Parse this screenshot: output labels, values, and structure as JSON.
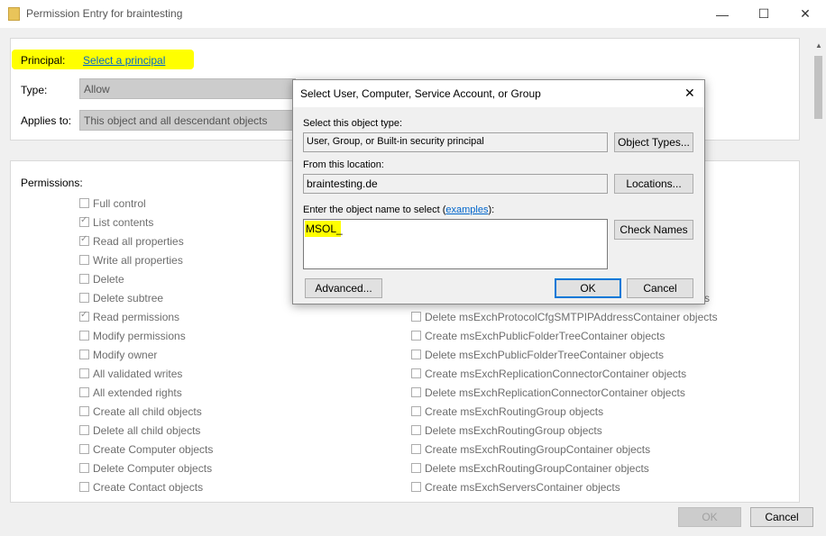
{
  "window": {
    "title": "Permission Entry for braintesting",
    "minimize": "—",
    "maximize": "☐",
    "close": "✕"
  },
  "principal": {
    "label": "Principal:",
    "link": "Select a principal",
    "highlight_color": "#ffff00"
  },
  "type": {
    "label": "Type:",
    "value": "Allow"
  },
  "applies": {
    "label": "Applies to:",
    "value": "This object and all descendant objects"
  },
  "permissions": {
    "label": "Permissions:",
    "left": [
      {
        "label": "Full control",
        "checked": false
      },
      {
        "label": "List contents",
        "checked": true
      },
      {
        "label": "Read all properties",
        "checked": true
      },
      {
        "label": "Write all properties",
        "checked": false
      },
      {
        "label": "Delete",
        "checked": false
      },
      {
        "label": "Delete subtree",
        "checked": false
      },
      {
        "label": "Read permissions",
        "checked": true
      },
      {
        "label": "Modify permissions",
        "checked": false
      },
      {
        "label": "Modify owner",
        "checked": false
      },
      {
        "label": "All validated writes",
        "checked": false
      },
      {
        "label": "All extended rights",
        "checked": false
      },
      {
        "label": "Create all child objects",
        "checked": false
      },
      {
        "label": "Delete all child objects",
        "checked": false
      },
      {
        "label": "Create Computer objects",
        "checked": false
      },
      {
        "label": "Delete Computer objects",
        "checked": false
      },
      {
        "label": "Create Contact objects",
        "checked": false
      }
    ],
    "right_partial": "s",
    "right": [
      {
        "label": "Delete msExchProtocolCfgSMTPIPAddressContainer objects",
        "checked": false
      },
      {
        "label": "Create msExchPublicFolderTreeContainer objects",
        "checked": false
      },
      {
        "label": "Delete msExchPublicFolderTreeContainer objects",
        "checked": false
      },
      {
        "label": "Create msExchReplicationConnectorContainer objects",
        "checked": false
      },
      {
        "label": "Delete msExchReplicationConnectorContainer objects",
        "checked": false
      },
      {
        "label": "Create msExchRoutingGroup objects",
        "checked": false
      },
      {
        "label": "Delete msExchRoutingGroup objects",
        "checked": false
      },
      {
        "label": "Create msExchRoutingGroupContainer objects",
        "checked": false
      },
      {
        "label": "Delete msExchRoutingGroupContainer objects",
        "checked": false
      },
      {
        "label": "Create msExchServersContainer objects",
        "checked": false
      }
    ]
  },
  "footer": {
    "ok": "OK",
    "cancel": "Cancel"
  },
  "dialog": {
    "title": "Select User, Computer, Service Account, or Group",
    "close": "✕",
    "object_type_label": "Select this object type:",
    "object_type_value": "User, Group, or Built-in security principal",
    "object_types_button": "Object Types...",
    "location_label": "From this location:",
    "location_value": "braintesting.de",
    "locations_button": "Locations...",
    "enter_label_prefix": "Enter the object name to select (",
    "enter_label_link": "examples",
    "enter_label_suffix": "):",
    "name_value": "MSOL_",
    "check_names_button": "Check Names",
    "advanced_button": "Advanced...",
    "ok_button": "OK",
    "cancel_button": "Cancel"
  }
}
